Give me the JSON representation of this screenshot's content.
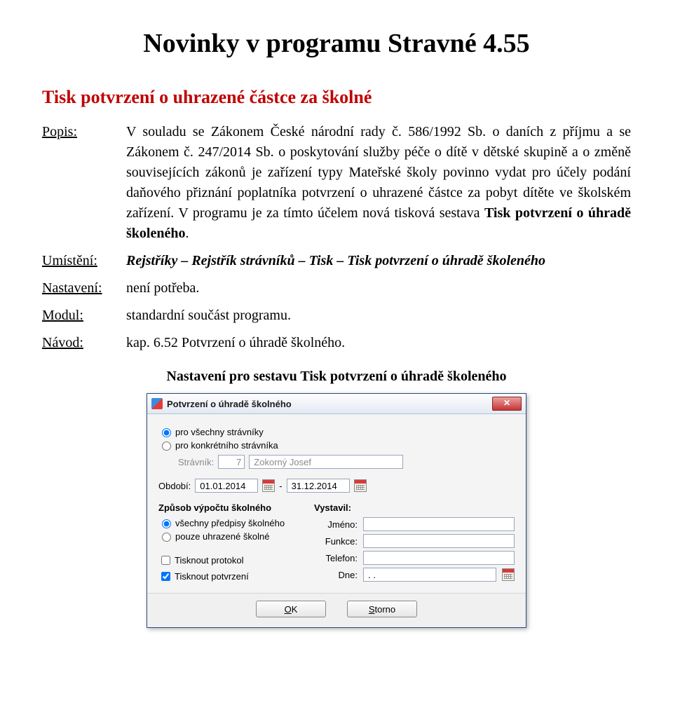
{
  "page_title": "Novinky v programu Stravné 4.55",
  "section_heading": "Tisk potvrzení o uhrazené částce za školné",
  "rows": {
    "popis": {
      "label": "Popis:",
      "text_before_bold": "V souladu se Zákonem České národní rady č. 586/1992 Sb. o daních z příjmu a se Zákonem č. 247/2014 Sb. o poskytování služby péče o dítě v dětské skupině a o změně souvisejících zákonů je zařízení typy Mateřské školy povinno vydat pro účely podání daňového přiznání poplatníka potvrzení o uhrazené částce za pobyt dítěte ve školském zařízení. V programu je za tímto účelem nová tisková sestava ",
      "text_bold": "Tisk potvrzení o úhradě školeného",
      "text_after_bold": "."
    },
    "umisteni": {
      "label": "Umístění:",
      "text": "Rejstříky – Rejstřík strávníků – Tisk – Tisk potvrzení o úhradě školeného"
    },
    "nastaveni": {
      "label": "Nastavení:",
      "text": "není potřeba."
    },
    "modul": {
      "label": "Modul:",
      "text": "standardní součást programu."
    },
    "navod": {
      "label": "Návod:",
      "text": "kap. 6.52 Potvrzení o úhradě školného."
    }
  },
  "picture_caption": "Nastavení pro sestavu Tisk potvrzení o úhradě školeného",
  "dialog": {
    "title": "Potvrzení o úhradě školného",
    "radios_top": {
      "all": "pro všechny strávníky",
      "one": "pro konkrétního strávníka"
    },
    "stravnik_label": "Strávník:",
    "stravnik_num": "7",
    "stravnik_name": "Zokorný Josef",
    "obdobi_label": "Období:",
    "date_from": "01.01.2014",
    "date_to": "31.12.2014",
    "calc_heading": "Způsob výpočtu školného",
    "radios_calc": {
      "all": "všechny předpisy školného",
      "paid": "pouze uhrazené školné"
    },
    "chk_protokol": "Tisknout protokol",
    "chk_potvrzeni": "Tisknout potvrzení",
    "vystavil_heading": "Vystavil:",
    "fields": {
      "jmeno": "Jméno:",
      "funkce": "Funkce:",
      "telefon": "Telefon:",
      "dne": "Dne:"
    },
    "dne_value": ". .",
    "btn_ok_u": "O",
    "btn_ok_rest": "K",
    "btn_storno_u": "S",
    "btn_storno_rest": "torno"
  }
}
